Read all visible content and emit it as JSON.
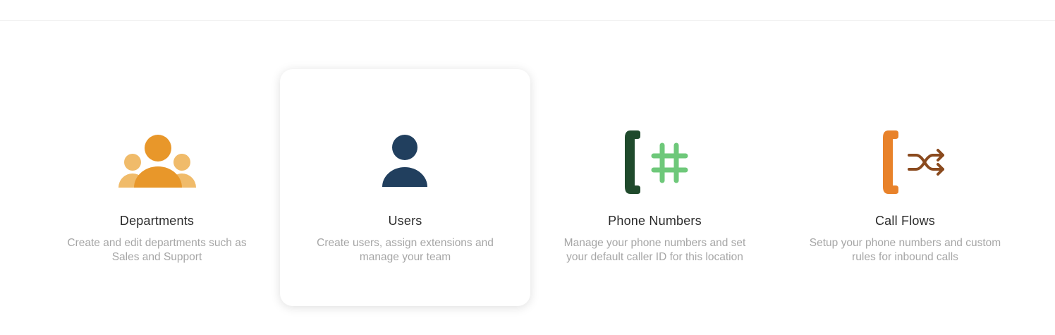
{
  "cards": [
    {
      "title": "Departments",
      "description": "Create and edit departments such as Sales and Support",
      "icon": "departments-group-icon",
      "colors": {
        "primary": "#e8972a",
        "secondary": "#f0bb6a"
      },
      "active": false
    },
    {
      "title": "Users",
      "description": "Create users, assign extensions and manage your team",
      "icon": "user-icon",
      "colors": {
        "primary": "#213f5e"
      },
      "active": true
    },
    {
      "title": "Phone Numbers",
      "description": "Manage your phone numbers and set your default caller ID for this location",
      "icon": "phone-hash-icon",
      "colors": {
        "primary": "#1f4a2c",
        "secondary": "#6ec87a"
      },
      "active": false
    },
    {
      "title": "Call Flows",
      "description": "Setup your phone numbers and custom rules for inbound calls",
      "icon": "phone-shuffle-icon",
      "colors": {
        "primary": "#e8822a",
        "secondary": "#8a4a1e"
      },
      "active": false
    }
  ]
}
